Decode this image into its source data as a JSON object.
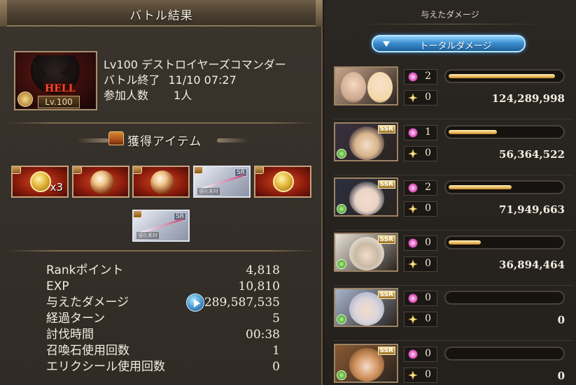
{
  "left": {
    "title": "バトル結果",
    "boss": {
      "difficulty": "HELL",
      "level_badge": "Lv.100"
    },
    "quest": {
      "name": "Lv100 デストロイヤーズコマンダー",
      "end_label": "バトル終了",
      "end_time": "11/10 07:27",
      "participants_label": "参加人数",
      "participants_value": "1人"
    },
    "items": {
      "title": "獲得アイテム",
      "list": [
        {
          "kind": "gold-medal",
          "qty": "x3"
        },
        {
          "kind": "orb"
        },
        {
          "kind": "orb"
        },
        {
          "kind": "weapon",
          "rarity": "SR",
          "tag": "強化素材"
        },
        {
          "kind": "gold-medal"
        },
        {
          "kind": "weapon",
          "rarity": "SR",
          "tag": "強化素材"
        }
      ]
    },
    "stats": [
      {
        "label": "Rankポイント",
        "value": "4,818"
      },
      {
        "label": "EXP",
        "value": "10,810"
      },
      {
        "label": "与えたダメージ",
        "value": "289,587,535"
      },
      {
        "label": "経過ターン",
        "value": "5"
      },
      {
        "label": "討伐時間",
        "value": "00:38"
      },
      {
        "label": "召喚石使用回数",
        "value": "1"
      },
      {
        "label": "エリクシール使用回数",
        "value": "0"
      }
    ]
  },
  "right": {
    "header": "与えたダメージ",
    "total_button": "トータルダメージ",
    "members": [
      {
        "ssr": "",
        "star_count": "2",
        "skill_count": "0",
        "bar": 0.95,
        "damage": "124,289,998"
      },
      {
        "ssr": "SSR",
        "star_count": "1",
        "skill_count": "0",
        "bar": 0.43,
        "damage": "56,364,522"
      },
      {
        "ssr": "SSR",
        "star_count": "2",
        "skill_count": "0",
        "bar": 0.56,
        "damage": "71,949,663"
      },
      {
        "ssr": "SSR",
        "star_count": "0",
        "skill_count": "0",
        "bar": 0.29,
        "damage": "36,894,464"
      },
      {
        "ssr": "SSR",
        "star_count": "0",
        "skill_count": "0",
        "bar": 0.0,
        "damage": "0"
      },
      {
        "ssr": "SSR",
        "star_count": "0",
        "skill_count": "0",
        "bar": 0.0,
        "damage": "0"
      }
    ]
  },
  "colors": {
    "accent_blue": "#3d8fd0",
    "bar_gold": "#f0c26a",
    "frame": "#9c8363"
  }
}
